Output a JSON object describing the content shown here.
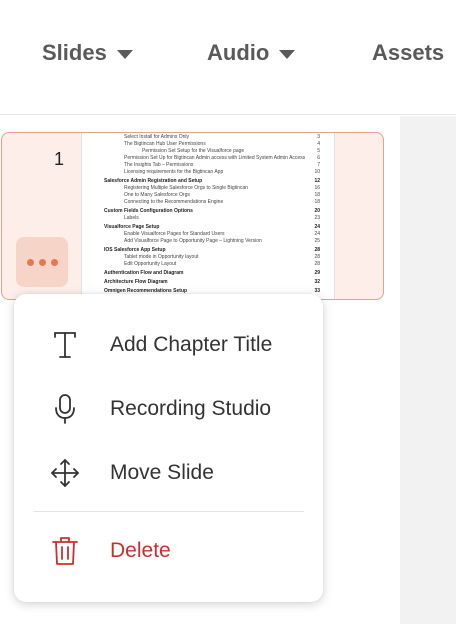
{
  "nav": {
    "slides": "Slides",
    "audio": "Audio",
    "assets": "Assets"
  },
  "slide": {
    "number": "1",
    "toc": [
      {
        "text": "Select Install for Admins Only",
        "page": "3",
        "level": 1
      },
      {
        "text": "The Bigtincan Hub User Permissions",
        "page": "4",
        "level": 1
      },
      {
        "text": "Permission Set Setup for the Visualforce page",
        "page": "5",
        "level": 2
      },
      {
        "text": "Permission Set Up for Bigtincan Admin access with Limited System Admin Access",
        "page": "6",
        "level": 1
      },
      {
        "text": "The Insights Tab – Permissions",
        "page": "7",
        "level": 1
      },
      {
        "text": "Licensing requirements for the Bigtincan App",
        "page": "10",
        "level": 1
      },
      {
        "text": "Salesforce Admin Registration and Setup",
        "page": "12",
        "level": 0
      },
      {
        "text": "Registering Multiple Salesforce Orgs to Single Bigtincan",
        "page": "16",
        "level": 1
      },
      {
        "text": "One to Many Salesforce Orgs",
        "page": "18",
        "level": 1
      },
      {
        "text": "Connecting to the Recommendations Engine",
        "page": "18",
        "level": 1
      },
      {
        "text": "Custom Fields Configuration Options",
        "page": "20",
        "level": 0
      },
      {
        "text": "Labels",
        "page": "23",
        "level": 1
      },
      {
        "text": "Visualforce Page Setup",
        "page": "24",
        "level": 0
      },
      {
        "text": "Enable Visualforce Pages for Standard Users",
        "page": "24",
        "level": 1
      },
      {
        "text": "Add Visualforce Page to Opportunity Page – Lightning Version",
        "page": "25",
        "level": 1
      },
      {
        "text": "IOS Salesforce App Setup",
        "page": "28",
        "level": 0
      },
      {
        "text": "Tablet mode in Opportunity layout",
        "page": "28",
        "level": 1
      },
      {
        "text": "Edit Opportunity Layout",
        "page": "28",
        "level": 1
      },
      {
        "text": "Authentication Flow and Diagram",
        "page": "29",
        "level": 0
      },
      {
        "text": "Architecture Flow Diagram",
        "page": "32",
        "level": 0
      },
      {
        "text": "Omnigen Recommendations Setup",
        "page": "33",
        "level": 0
      }
    ]
  },
  "menu": {
    "items": [
      {
        "label": "Add Chapter Title",
        "icon": "text-icon"
      },
      {
        "label": "Recording Studio",
        "icon": "microphone-icon"
      },
      {
        "label": "Move Slide",
        "icon": "move-arrows-icon"
      },
      {
        "label": "Delete",
        "icon": "trash-icon"
      }
    ]
  },
  "colors": {
    "accent": "#e07a52",
    "danger": "#c9302c",
    "card_bg": "#fdeee9",
    "card_border": "#e8a08a"
  }
}
